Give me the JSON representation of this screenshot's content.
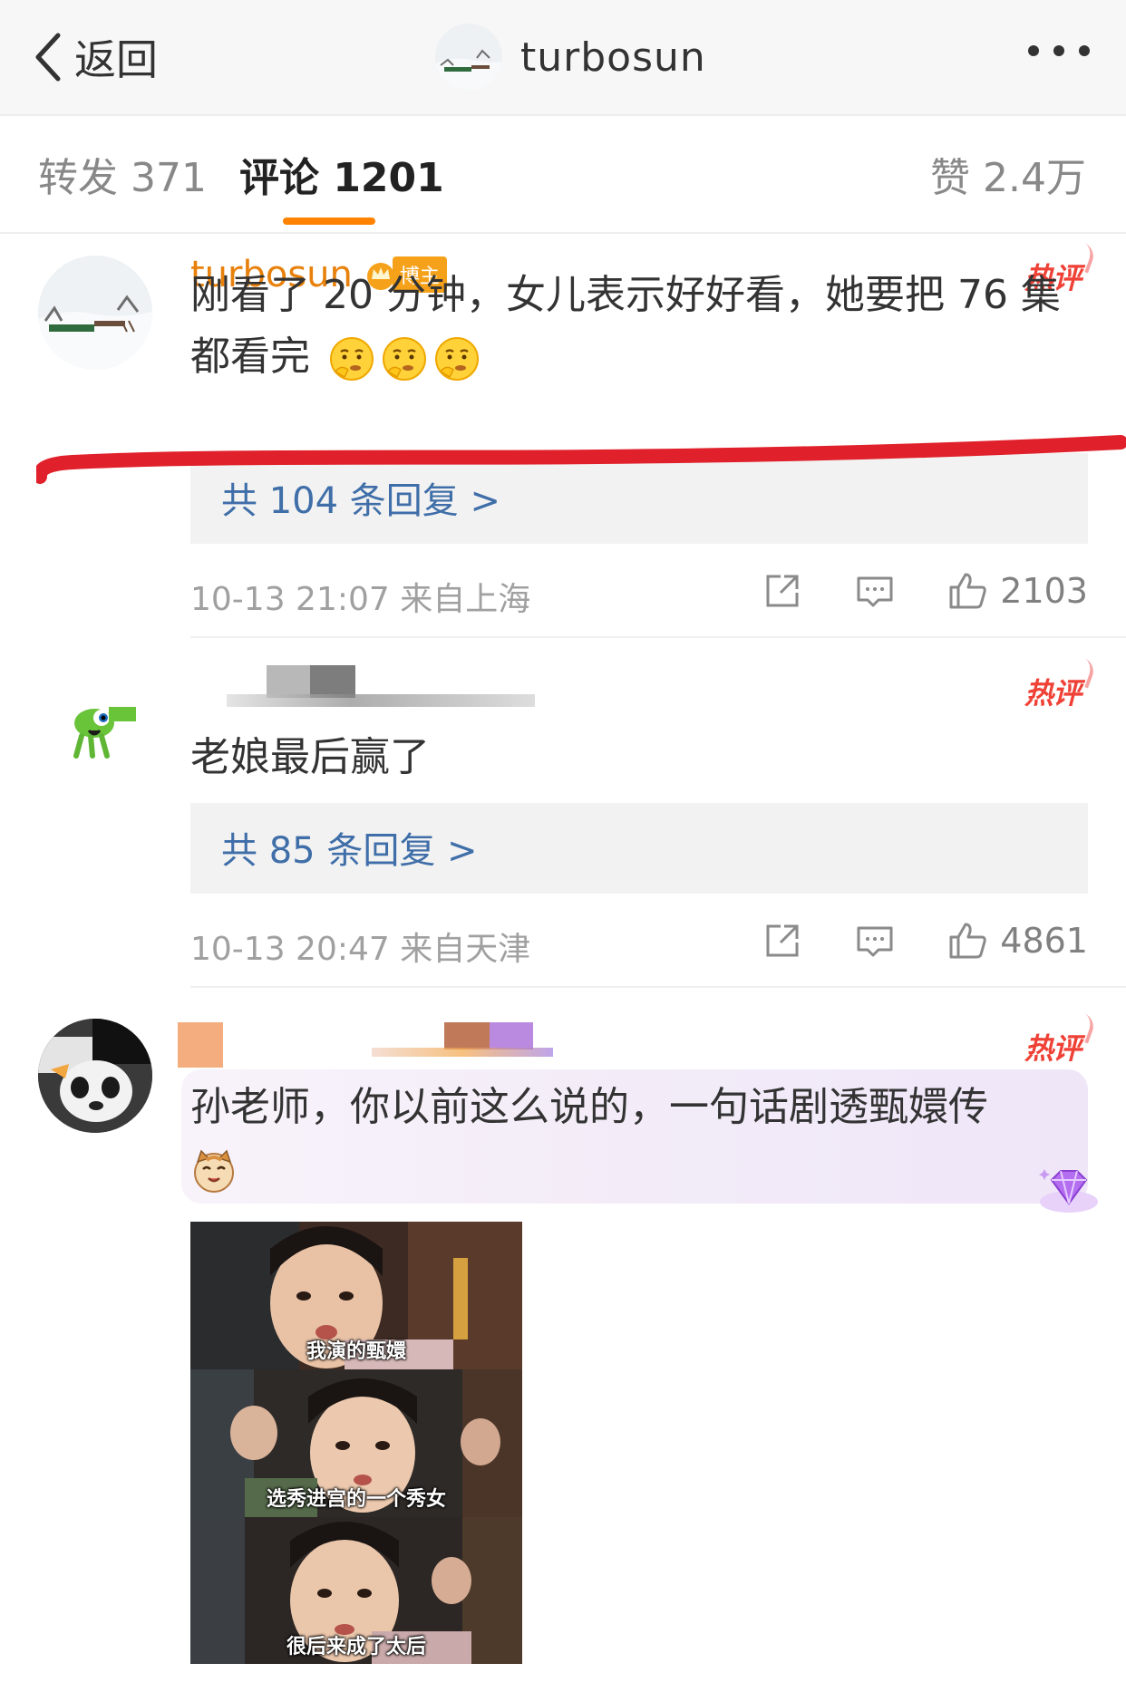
{
  "navbar": {
    "back_label": "返回",
    "title": "turbosun"
  },
  "tabs": {
    "repost": "转发 371",
    "comments": "评论 1201",
    "likes": "赞 2.4万"
  },
  "comments": [
    {
      "username": "turbosun",
      "badge": "博主",
      "hot_label": "热评",
      "text": "刚看了 20 分钟，女儿表示好好看，她要把 76 集都看完",
      "emojis": [
        "thinking-emoji",
        "thinking-emoji",
        "thinking-emoji"
      ],
      "replies_label": "共 104 条回复 >",
      "meta": "10-13 21:07  来自上海",
      "likes": "2103"
    },
    {
      "username": "",
      "hot_label": "热评",
      "text": "老娘最后赢了",
      "replies_label": "共 85 条回复 >",
      "meta": "10-13 20:47  来自天津",
      "likes": "4861"
    },
    {
      "username": "",
      "hot_label": "热评",
      "text": "孙老师，你以前这么说的，一句话剧透甄嬛传",
      "emojis": [
        "cat-emoji"
      ],
      "image_captions": [
        "我演的甄嬛",
        "选秀进宫的一个秀女",
        "很后来成了太后"
      ]
    }
  ],
  "colors": {
    "accent": "#ff8200",
    "username": "#e8810c",
    "hot": "#ef4136",
    "link": "#3f6ea8",
    "annotation": "#e0202a"
  }
}
